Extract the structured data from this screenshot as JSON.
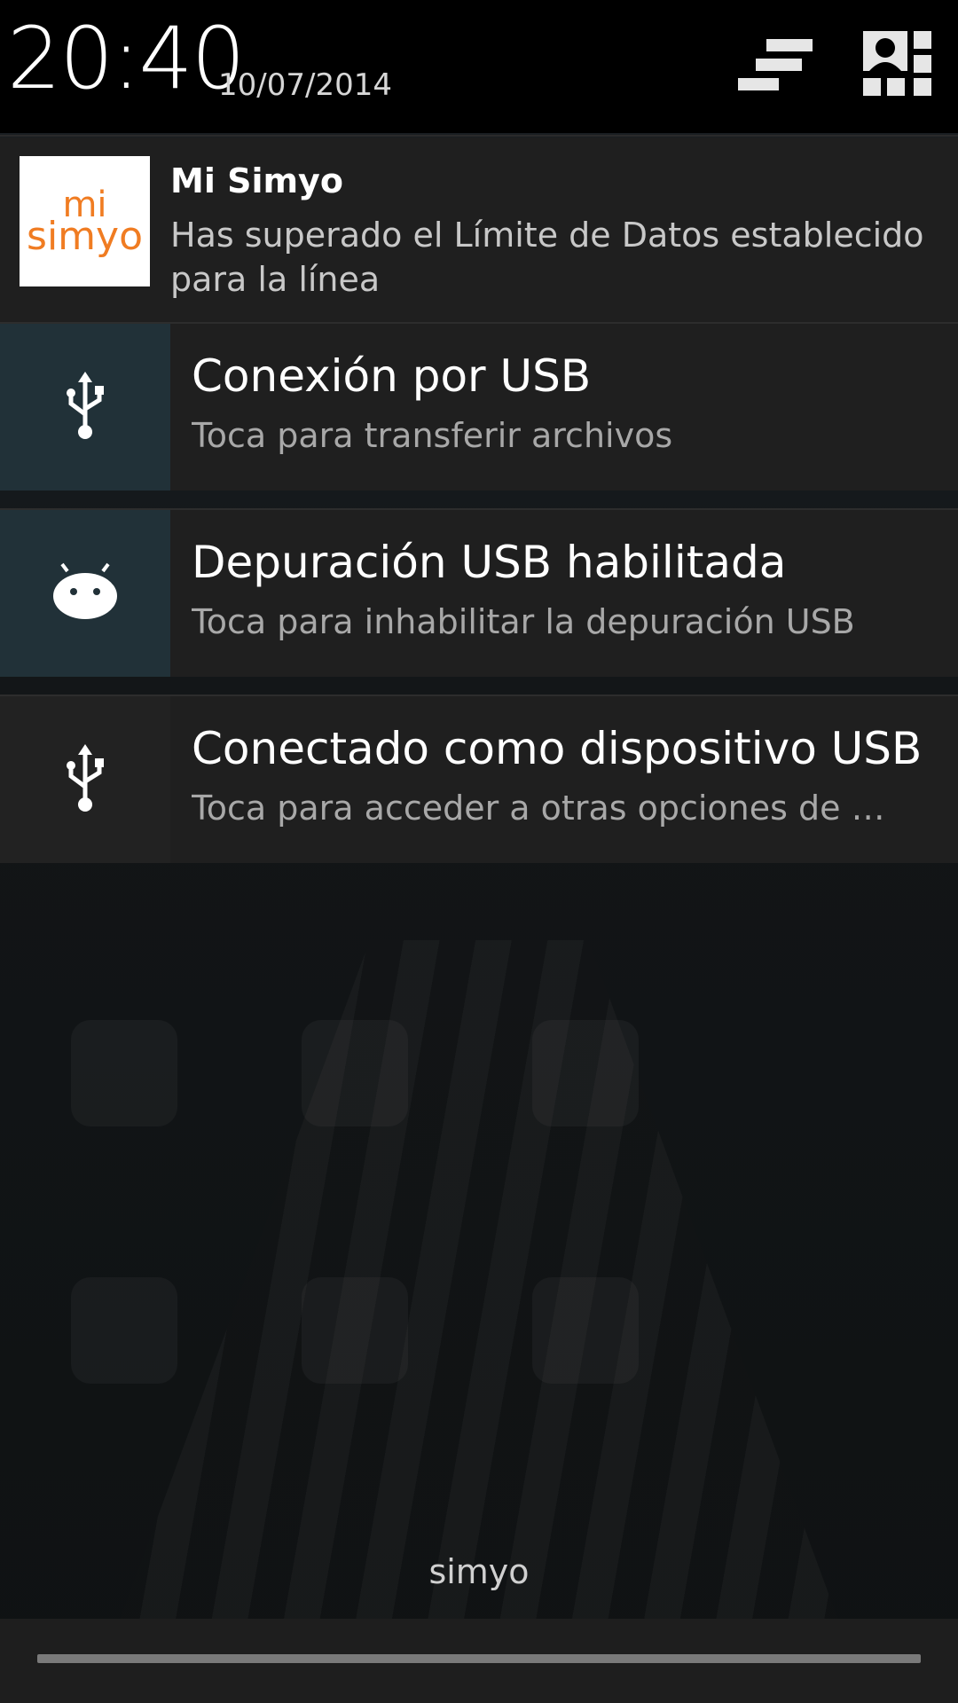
{
  "header": {
    "time": "20:40",
    "date": "10/07/2014"
  },
  "notifications": [
    {
      "app": "Mi Simyo",
      "icon": "mi-simyo-logo",
      "logo_text": [
        "mi",
        "simyo"
      ],
      "text": "Has superado el Límite de Datos establecido para la línea"
    },
    {
      "title": "Conexión por USB",
      "text": "Toca para transferir archivos",
      "icon": "usb-icon"
    },
    {
      "title": "Depuración USB habilitada",
      "text": "Toca para inhabilitar la depuración USB",
      "icon": "android-debug-icon"
    },
    {
      "title": "Conectado como dispositivo USB",
      "text": "Toca para acceder a otras opciones de U…",
      "icon": "usb-icon"
    }
  ],
  "carrier": "simyo",
  "colors": {
    "simyo_orange": "#f07c22",
    "icon_box_teal": "#213138",
    "header_bg": "#000000",
    "notification_bg": "#1f1f1f"
  }
}
